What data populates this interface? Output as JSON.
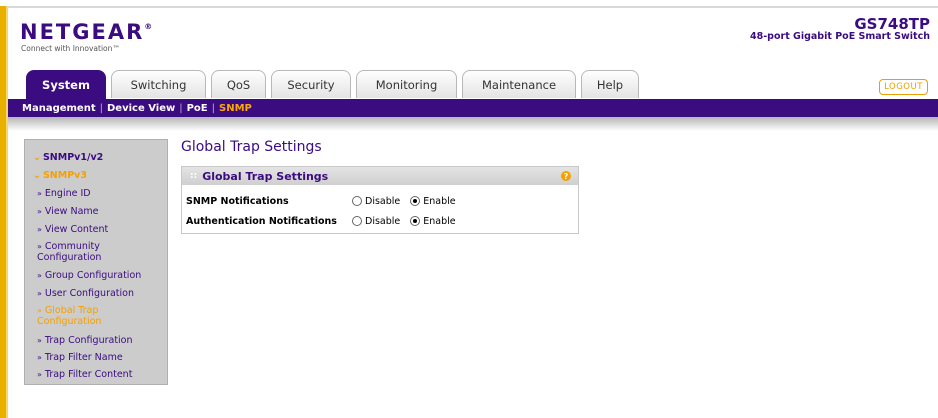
{
  "header": {
    "logo_text": "NETGEAR",
    "logo_mark": "®",
    "tagline": "Connect with Innovation™",
    "model": "GS748TP",
    "model_desc": "48-port Gigabit PoE Smart Switch"
  },
  "tabs": [
    {
      "label": "System",
      "active": true
    },
    {
      "label": "Switching",
      "active": false
    },
    {
      "label": "QoS",
      "active": false
    },
    {
      "label": "Security",
      "active": false
    },
    {
      "label": "Monitoring",
      "active": false
    },
    {
      "label": "Maintenance",
      "active": false
    },
    {
      "label": "Help",
      "active": false
    }
  ],
  "logout_label": "LOGOUT",
  "subnav": {
    "items": [
      "Management",
      "Device View",
      "PoE",
      "SNMP"
    ],
    "separator": "|",
    "current": "SNMP"
  },
  "sidebar": {
    "snmpv1v2": "SNMPv1/v2",
    "snmpv3": "SNMPv3",
    "chevron": "⌄",
    "arrow": "»",
    "items": [
      "Engine ID",
      "View Name",
      "View Content",
      "Community",
      "Configuration",
      "Group Configuration",
      "User Configuration",
      "Global Trap",
      "Configuration",
      "Trap Configuration",
      "Trap Filter Name",
      "Trap Filter Content"
    ]
  },
  "page_title": "Global Trap Settings",
  "panel": {
    "title": "Global Trap Settings",
    "dots": "::",
    "help": "?",
    "rows": [
      {
        "label": "SNMP Notifications",
        "disable": "Disable",
        "enable": "Enable",
        "selected": "enable"
      },
      {
        "label": "Authentication Notifications",
        "disable": "Disable",
        "enable": "Enable",
        "selected": "enable"
      }
    ]
  },
  "colors": {
    "brand_purple": "#3b0b80",
    "accent_orange": "#f4a000",
    "sidebar_bg": "#cccccc"
  }
}
